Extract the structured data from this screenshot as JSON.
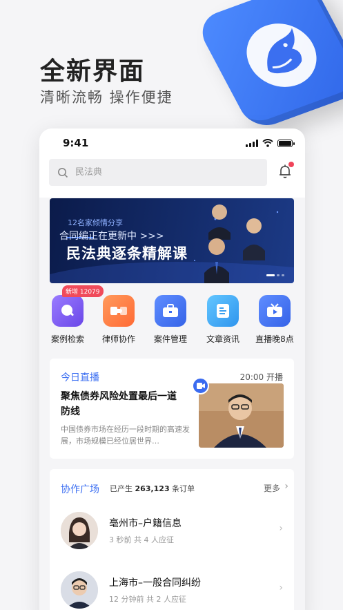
{
  "promo": {
    "title": "全新界面",
    "subtitle": "清晰流畅 操作便捷"
  },
  "status": {
    "time": "9:41"
  },
  "search": {
    "placeholder": "民法典"
  },
  "banner": {
    "line1": "12名家倾情分享",
    "line2": "合同编正在更新中 >>>",
    "line3": "民法典逐条精解课"
  },
  "quick_items": [
    {
      "label": "案例检索",
      "badge": "新增 12079",
      "icon": "search-case-icon",
      "color": "#7a5cf0"
    },
    {
      "label": "律师协作",
      "icon": "handshake-icon",
      "color": "#ff7a45"
    },
    {
      "label": "案件管理",
      "icon": "briefcase-icon",
      "color": "#3c6ff2"
    },
    {
      "label": "文章资讯",
      "icon": "article-icon",
      "color": "#38a4f0"
    },
    {
      "label": "直播晚8点",
      "icon": "video-icon",
      "color": "#3c6ff2"
    }
  ],
  "live": {
    "header": "今日直播",
    "time": "20:00 开播",
    "title": "聚焦债券风险处置最后一道防线",
    "desc": "中国债券市场在经历一段时期的高速发展，市场规模已经位居世界…"
  },
  "collab": {
    "header": "协作广场",
    "stat_prefix": "已产生",
    "stat_count": "263,123",
    "stat_suffix": "条订单",
    "more": "更多",
    "items": [
      {
        "title": "亳州市–户籍信息",
        "meta": "3 秒前 共 4 人应征"
      },
      {
        "title": "上海市–一般合同纠纷",
        "meta": "12 分钟前 共 2 人应征"
      }
    ]
  }
}
